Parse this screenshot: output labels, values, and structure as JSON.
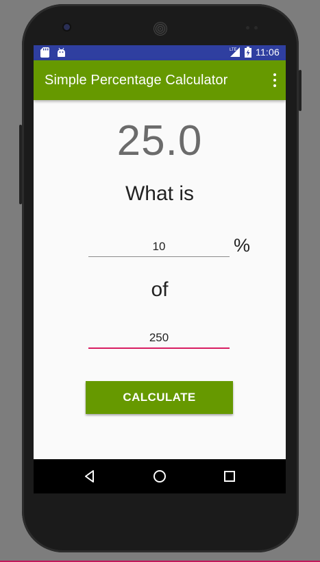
{
  "status_bar": {
    "time": "11:06",
    "network": "LTE",
    "left_icons": [
      "sd-card-icon",
      "android-icon"
    ],
    "right_icons": [
      "lte-signal-icon",
      "battery-charging-icon"
    ]
  },
  "app_bar": {
    "title": "Simple Percentage Calculator",
    "menu_icon": "overflow-menu-icon"
  },
  "result": "25.0",
  "labels": {
    "what_is": "What is",
    "percent_sign": "%",
    "of": "of"
  },
  "inputs": {
    "percent_value": "10",
    "amount_value": "250"
  },
  "button": {
    "calculate_label": "CALCULATE"
  },
  "nav": {
    "icons": [
      "back-icon",
      "home-icon",
      "recents-icon"
    ]
  },
  "colors": {
    "app_bar": "#669900",
    "status_bar": "#2f3fa0",
    "accent": "#d81b60",
    "button": "#669900"
  }
}
